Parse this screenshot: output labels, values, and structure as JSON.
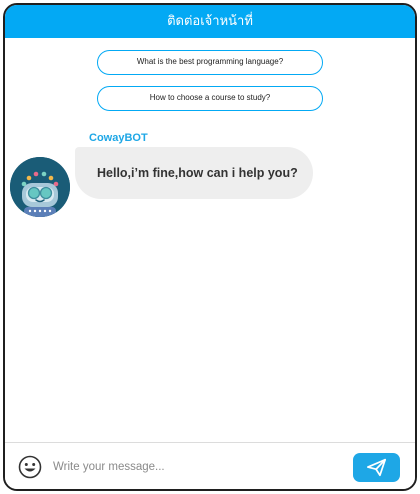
{
  "header": {
    "title": "ติดต่อเจ้าหน้าที่"
  },
  "suggestions": [
    {
      "label": "What is the best programming language?"
    },
    {
      "label": "How to choose a course to study?"
    }
  ],
  "conversation": {
    "bot_name": "CowayBOT",
    "messages": [
      {
        "sender": "bot",
        "text": "Hello,i’m fine,how can i help you?"
      }
    ]
  },
  "composer": {
    "placeholder": "Write your message...",
    "value": "",
    "emoji_icon": "emoji-smile-icon",
    "send_icon": "paper-plane-icon"
  },
  "colors": {
    "accent": "#03a9f4",
    "bot_name": "#1ea7e6",
    "bubble_bg": "#eeeeee",
    "avatar_bg": "#1a5c77"
  }
}
